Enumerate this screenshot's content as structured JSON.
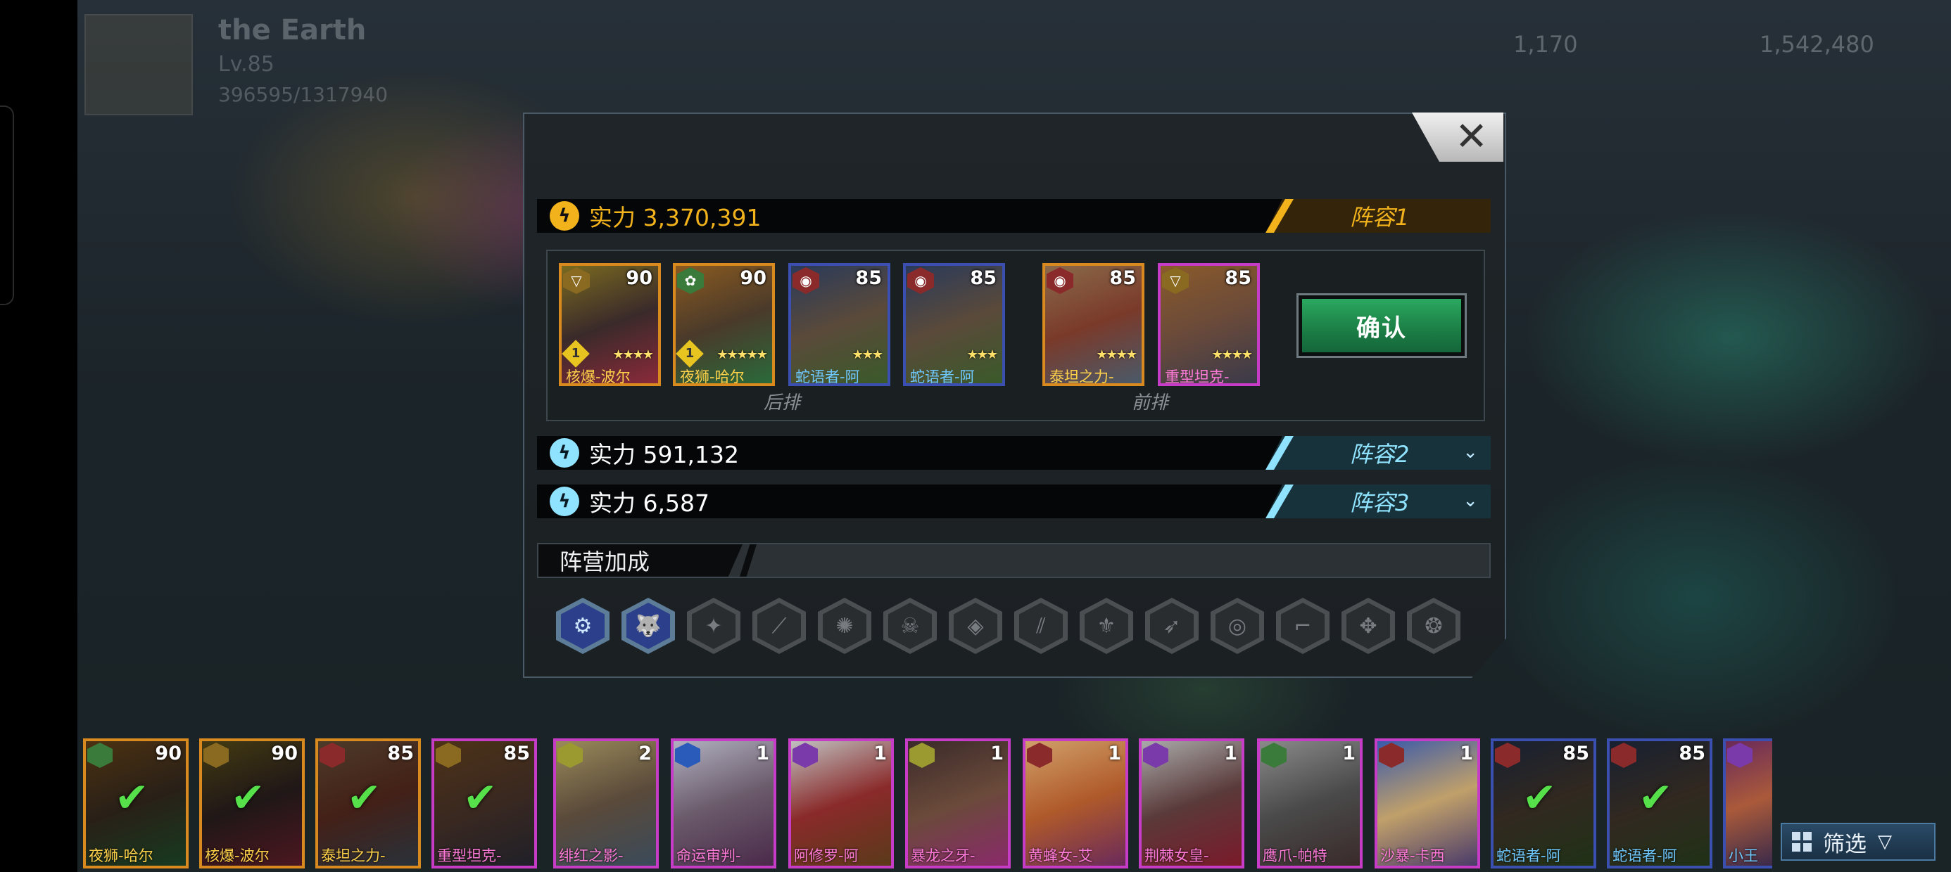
{
  "hud": {
    "player_name": "the Earth",
    "level": "Lv.85",
    "exp": "396595/1317940",
    "resource_gems": "1,170",
    "resource_gold": "1,542,480"
  },
  "modal": {
    "close_label": "✕",
    "lineups": [
      {
        "power_label": "实力 3,370,391",
        "tab_label": "阵容1",
        "expanded": true,
        "color": "#f2b21c"
      },
      {
        "power_label": "实力 591,132",
        "tab_label": "阵容2",
        "expanded": false,
        "color": "#8fe3ff"
      },
      {
        "power_label": "实力 6,587",
        "tab_label": "阵容3",
        "expanded": false,
        "color": "#8fe3ff"
      }
    ],
    "team": {
      "back_row_label": "后排",
      "front_row_label": "前排",
      "confirm_label": "确认",
      "heroes": [
        {
          "name": "核爆-波尔",
          "level": "90",
          "rank": "1",
          "border": "#d98a1e"
        },
        {
          "name": "夜狮-哈尔",
          "level": "90",
          "rank": "1",
          "border": "#d98a1e"
        },
        {
          "name": "蛇语者-阿",
          "level": "85",
          "rank": "",
          "border": "#3b4fb0"
        },
        {
          "name": "蛇语者-阿",
          "level": "85",
          "rank": "",
          "border": "#3b4fb0"
        },
        {
          "name": "泰坦之力-",
          "level": "85",
          "rank": "",
          "border": "#d98a1e"
        },
        {
          "name": "重型坦克-",
          "level": "85",
          "rank": "",
          "border": "#c73cc7"
        }
      ]
    },
    "faction": {
      "title": "阵营加成",
      "icons": [
        {
          "icon": "robot-arm-icon",
          "active": true
        },
        {
          "icon": "wolf-icon",
          "active": true
        },
        {
          "icon": "claw-icon",
          "active": false
        },
        {
          "icon": "blade-icon",
          "active": false
        },
        {
          "icon": "flame-icon",
          "active": false
        },
        {
          "icon": "skull-icon",
          "active": false
        },
        {
          "icon": "mask-icon",
          "active": false
        },
        {
          "icon": "slash-icon",
          "active": false
        },
        {
          "icon": "wings-icon",
          "active": false
        },
        {
          "icon": "eagle-icon",
          "active": false
        },
        {
          "icon": "spiral-icon",
          "active": false
        },
        {
          "icon": "gun-icon",
          "active": false
        },
        {
          "icon": "beast-icon",
          "active": false
        },
        {
          "icon": "gear-icon",
          "active": false
        }
      ]
    }
  },
  "roster": {
    "filter_label": "筛选",
    "heroes": [
      {
        "name": "夜狮-哈尔",
        "level": "90",
        "used": true,
        "border": "#d98a1e"
      },
      {
        "name": "核爆-波尔",
        "level": "90",
        "used": true,
        "border": "#d98a1e"
      },
      {
        "name": "泰坦之力-",
        "level": "85",
        "used": true,
        "border": "#d98a1e"
      },
      {
        "name": "重型坦克-",
        "level": "85",
        "used": true,
        "border": "#c73cc7"
      },
      {
        "name": "绯红之影-",
        "level": "2",
        "used": false,
        "border": "#c73cc7"
      },
      {
        "name": "命运审判-",
        "level": "1",
        "used": false,
        "border": "#c73cc7"
      },
      {
        "name": "阿修罗-阿",
        "level": "1",
        "used": false,
        "border": "#c73cc7"
      },
      {
        "name": "暴龙之牙-",
        "level": "1",
        "used": false,
        "border": "#c73cc7"
      },
      {
        "name": "黄蜂女-艾",
        "level": "1",
        "used": false,
        "border": "#c73cc7"
      },
      {
        "name": "荆棘女皇-",
        "level": "1",
        "used": false,
        "border": "#c73cc7"
      },
      {
        "name": "鹰爪-帕特",
        "level": "1",
        "used": false,
        "border": "#c73cc7"
      },
      {
        "name": "沙暴-卡西",
        "level": "1",
        "used": false,
        "border": "#c73cc7"
      },
      {
        "name": "蛇语者-阿",
        "level": "85",
        "used": true,
        "border": "#3b4fb0"
      },
      {
        "name": "蛇语者-阿",
        "level": "85",
        "used": true,
        "border": "#3b4fb0"
      },
      {
        "name": "小王",
        "level": "",
        "used": false,
        "border": "#3b4fb0"
      }
    ]
  }
}
